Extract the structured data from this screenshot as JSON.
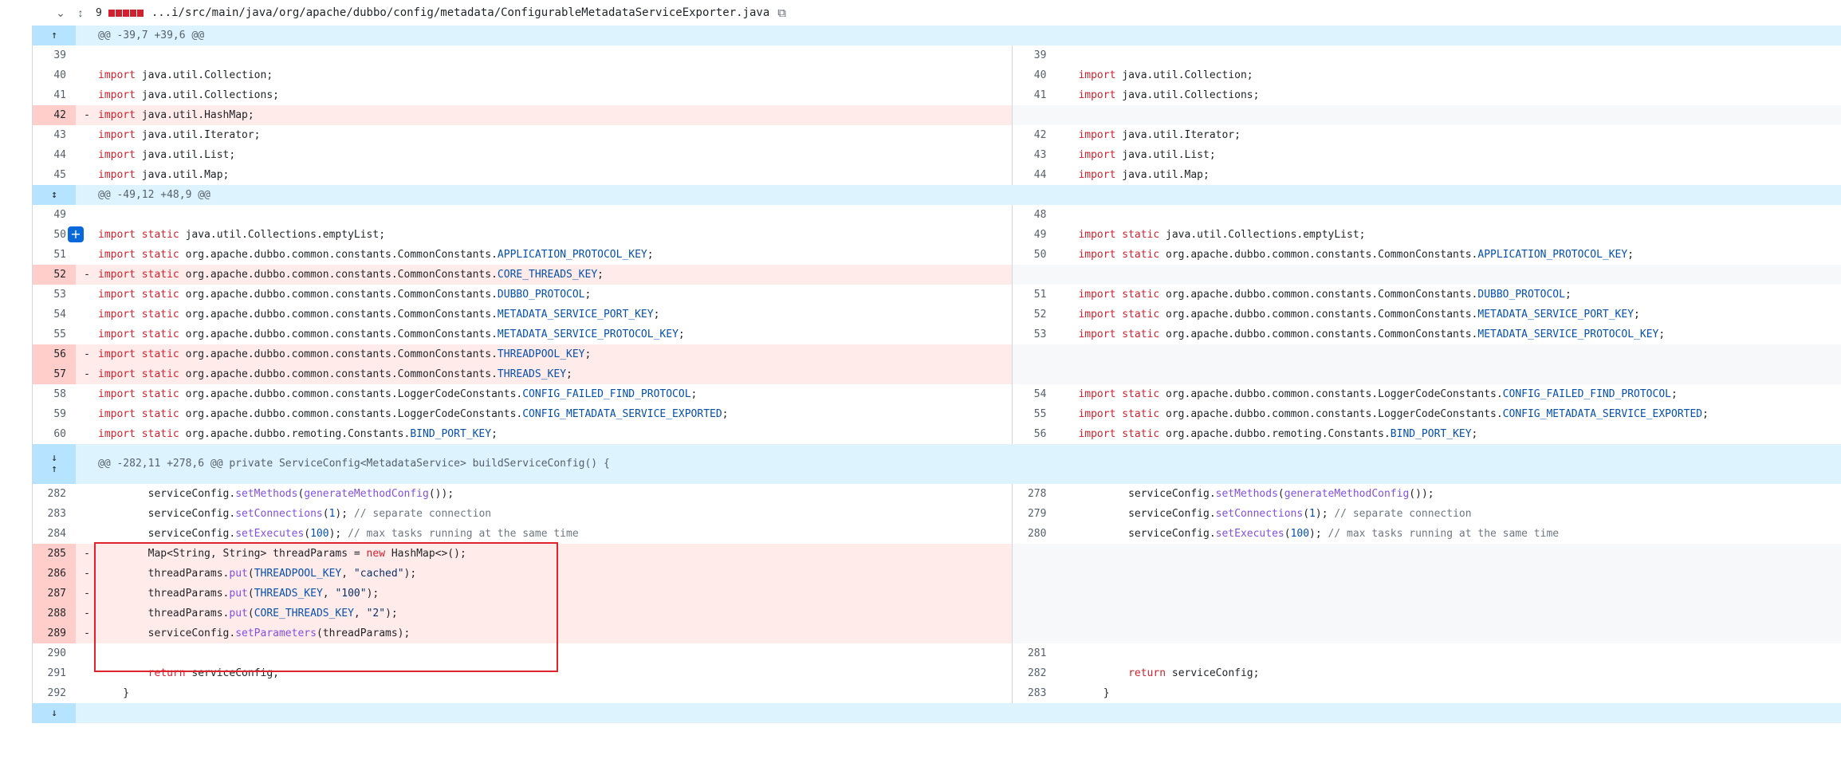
{
  "file_header": {
    "chevron": "chevron-down",
    "expand_icon": "unfold-icon",
    "change_count": "9",
    "path": "...i/src/main/java/org/apache/dubbo/config/metadata/ConfigurableMetadataServiceExporter.java",
    "copy_icon": "copy-icon"
  },
  "hunks": [
    {
      "header": "@@ -39,7 +39,6 @@",
      "rows": [
        {
          "l": "39",
          "lm": "",
          "lc": [],
          "r": "39",
          "rc": [],
          "t": "ctx"
        },
        {
          "l": "40",
          "lc": [
            [
              "kw",
              "import"
            ],
            [
              "",
              "java.util.Collection;"
            ]
          ],
          "r": "40",
          "rc": [
            [
              "kw",
              "import"
            ],
            [
              "",
              "java.util.Collection;"
            ]
          ],
          "t": "ctx"
        },
        {
          "l": "41",
          "lc": [
            [
              "kw",
              "import"
            ],
            [
              "",
              "java.util.Collections;"
            ]
          ],
          "r": "41",
          "rc": [
            [
              "kw",
              "import"
            ],
            [
              "",
              "java.util.Collections;"
            ]
          ],
          "t": "ctx"
        },
        {
          "l": "42",
          "lc": [
            [
              "kw",
              "import"
            ],
            [
              "",
              "java.util.HashMap;"
            ]
          ],
          "r": "",
          "rc": [],
          "t": "del"
        },
        {
          "l": "43",
          "lc": [
            [
              "kw",
              "import"
            ],
            [
              "",
              "java.util.Iterator;"
            ]
          ],
          "r": "42",
          "rc": [
            [
              "kw",
              "import"
            ],
            [
              "",
              "java.util.Iterator;"
            ]
          ],
          "t": "ctx"
        },
        {
          "l": "44",
          "lc": [
            [
              "kw",
              "import"
            ],
            [
              "",
              "java.util.List;"
            ]
          ],
          "r": "43",
          "rc": [
            [
              "kw",
              "import"
            ],
            [
              "",
              "java.util.List;"
            ]
          ],
          "t": "ctx"
        },
        {
          "l": "45",
          "lc": [
            [
              "kw",
              "import"
            ],
            [
              "",
              "java.util.Map;"
            ]
          ],
          "r": "44",
          "rc": [
            [
              "kw",
              "import"
            ],
            [
              "",
              "java.util.Map;"
            ]
          ],
          "t": "ctx"
        }
      ]
    },
    {
      "header": "@@ -49,12 +48,9 @@",
      "rows": [
        {
          "l": "49",
          "lc": [],
          "r": "48",
          "rc": [],
          "t": "ctx"
        },
        {
          "l": "50",
          "plus": true,
          "lc": [
            [
              "kw",
              "import static"
            ],
            [
              "",
              "java.util.Collections.emptyList;"
            ]
          ],
          "r": "49",
          "rc": [
            [
              "kw",
              "import static"
            ],
            [
              "",
              "java.util.Collections.emptyList;"
            ]
          ],
          "t": "ctx"
        },
        {
          "l": "51",
          "lc": [
            [
              "kw",
              "import static"
            ],
            [
              "",
              "org.apache.dubbo.common.constants.CommonConstants."
            ],
            [
              "const",
              "APPLICATION_PROTOCOL_KEY"
            ],
            [
              "",
              ";"
            ]
          ],
          "r": "50",
          "rc": [
            [
              "kw",
              "import static"
            ],
            [
              "",
              "org.apache.dubbo.common.constants.CommonConstants."
            ],
            [
              "const",
              "APPLICATION_PROTOCOL_KEY"
            ],
            [
              "",
              ";"
            ]
          ],
          "t": "ctx"
        },
        {
          "l": "52",
          "lc": [
            [
              "kw",
              "import static"
            ],
            [
              "",
              "org.apache.dubbo.common.constants.CommonConstants."
            ],
            [
              "const",
              "CORE_THREADS_KEY"
            ],
            [
              "",
              ";"
            ]
          ],
          "r": "",
          "rc": [],
          "t": "del"
        },
        {
          "l": "53",
          "lc": [
            [
              "kw",
              "import static"
            ],
            [
              "",
              "org.apache.dubbo.common.constants.CommonConstants."
            ],
            [
              "const",
              "DUBBO_PROTOCOL"
            ],
            [
              "",
              ";"
            ]
          ],
          "r": "51",
          "rc": [
            [
              "kw",
              "import static"
            ],
            [
              "",
              "org.apache.dubbo.common.constants.CommonConstants."
            ],
            [
              "const",
              "DUBBO_PROTOCOL"
            ],
            [
              "",
              ";"
            ]
          ],
          "t": "ctx"
        },
        {
          "l": "54",
          "lc": [
            [
              "kw",
              "import static"
            ],
            [
              "",
              "org.apache.dubbo.common.constants.CommonConstants."
            ],
            [
              "const",
              "METADATA_SERVICE_PORT_KEY"
            ],
            [
              "",
              ";"
            ]
          ],
          "r": "52",
          "rc": [
            [
              "kw",
              "import static"
            ],
            [
              "",
              "org.apache.dubbo.common.constants.CommonConstants."
            ],
            [
              "const",
              "METADATA_SERVICE_PORT_KEY"
            ],
            [
              "",
              ";"
            ]
          ],
          "t": "ctx"
        },
        {
          "l": "55",
          "lc": [
            [
              "kw",
              "import static"
            ],
            [
              "",
              "org.apache.dubbo.common.constants.CommonConstants."
            ],
            [
              "const",
              "METADATA_SERVICE_PROTOCOL_KEY"
            ],
            [
              "",
              ";"
            ]
          ],
          "r": "53",
          "rc": [
            [
              "kw",
              "import static"
            ],
            [
              "",
              "org.apache.dubbo.common.constants.CommonConstants."
            ],
            [
              "const",
              "METADATA_SERVICE_PROTOCOL_KEY"
            ],
            [
              "",
              ";"
            ]
          ],
          "t": "ctx"
        },
        {
          "l": "56",
          "lc": [
            [
              "kw",
              "import static"
            ],
            [
              "",
              "org.apache.dubbo.common.constants.CommonConstants."
            ],
            [
              "const",
              "THREADPOOL_KEY"
            ],
            [
              "",
              ";"
            ]
          ],
          "r": "",
          "rc": [],
          "t": "del"
        },
        {
          "l": "57",
          "lc": [
            [
              "kw",
              "import static"
            ],
            [
              "",
              "org.apache.dubbo.common.constants.CommonConstants."
            ],
            [
              "const",
              "THREADS_KEY"
            ],
            [
              "",
              ";"
            ]
          ],
          "r": "",
          "rc": [],
          "t": "del"
        },
        {
          "l": "58",
          "lc": [
            [
              "kw",
              "import static"
            ],
            [
              "",
              "org.apache.dubbo.common.constants.LoggerCodeConstants."
            ],
            [
              "const",
              "CONFIG_FAILED_FIND_PROTOCOL"
            ],
            [
              "",
              ";"
            ]
          ],
          "r": "54",
          "rc": [
            [
              "kw",
              "import static"
            ],
            [
              "",
              "org.apache.dubbo.common.constants.LoggerCodeConstants."
            ],
            [
              "const",
              "CONFIG_FAILED_FIND_PROTOCOL"
            ],
            [
              "",
              ";"
            ]
          ],
          "t": "ctx"
        },
        {
          "l": "59",
          "lc": [
            [
              "kw",
              "import static"
            ],
            [
              "",
              "org.apache.dubbo.common.constants.LoggerCodeConstants."
            ],
            [
              "const",
              "CONFIG_METADATA_SERVICE_EXPORTED"
            ],
            [
              "",
              ";"
            ]
          ],
          "r": "55",
          "rc": [
            [
              "kw",
              "import static"
            ],
            [
              "",
              "org.apache.dubbo.common.constants.LoggerCodeConstants."
            ],
            [
              "const",
              "CONFIG_METADATA_SERVICE_EXPORTED"
            ],
            [
              "",
              ";"
            ]
          ],
          "t": "ctx"
        },
        {
          "l": "60",
          "lc": [
            [
              "kw",
              "import static"
            ],
            [
              "",
              "org.apache.dubbo.remoting.Constants."
            ],
            [
              "const",
              "BIND_PORT_KEY"
            ],
            [
              "",
              ";"
            ]
          ],
          "r": "56",
          "rc": [
            [
              "kw",
              "import static"
            ],
            [
              "",
              "org.apache.dubbo.remoting.Constants."
            ],
            [
              "const",
              "BIND_PORT_KEY"
            ],
            [
              "",
              ";"
            ]
          ],
          "t": "ctx"
        }
      ]
    },
    {
      "header": "@@ -282,11 +278,6 @@ private ServiceConfig<MetadataService> buildServiceConfig() {",
      "rows": [
        {
          "l": "282",
          "lc": [
            [
              "",
              "        serviceConfig."
            ],
            [
              "fn",
              "setMethods"
            ],
            [
              "",
              "("
            ],
            [
              "fn",
              "generateMethodConfig"
            ],
            [
              "",
              "());"
            ]
          ],
          "r": "278",
          "rc": [
            [
              "",
              "        serviceConfig."
            ],
            [
              "fn",
              "setMethods"
            ],
            [
              "",
              "("
            ],
            [
              "fn",
              "generateMethodConfig"
            ],
            [
              "",
              "());"
            ]
          ],
          "t": "ctx"
        },
        {
          "l": "283",
          "lc": [
            [
              "",
              "        serviceConfig."
            ],
            [
              "fn",
              "setConnections"
            ],
            [
              "",
              "("
            ],
            [
              "const",
              "1"
            ],
            [
              "",
              "); "
            ],
            [
              "cm",
              "// separate connection"
            ]
          ],
          "r": "279",
          "rc": [
            [
              "",
              "        serviceConfig."
            ],
            [
              "fn",
              "setConnections"
            ],
            [
              "",
              "("
            ],
            [
              "const",
              "1"
            ],
            [
              "",
              "); "
            ],
            [
              "cm",
              "// separate connection"
            ]
          ],
          "t": "ctx"
        },
        {
          "l": "284",
          "lc": [
            [
              "",
              "        serviceConfig."
            ],
            [
              "fn",
              "setExecutes"
            ],
            [
              "",
              "("
            ],
            [
              "const",
              "100"
            ],
            [
              "",
              "); "
            ],
            [
              "cm",
              "// max tasks running at the same time"
            ]
          ],
          "r": "280",
          "rc": [
            [
              "",
              "        serviceConfig."
            ],
            [
              "fn",
              "setExecutes"
            ],
            [
              "",
              "("
            ],
            [
              "const",
              "100"
            ],
            [
              "",
              "); "
            ],
            [
              "cm",
              "// max tasks running at the same time"
            ]
          ],
          "t": "ctx"
        },
        {
          "l": "285",
          "lc": [
            [
              "",
              "        Map<String, String> threadParams = "
            ],
            [
              "kw",
              "new"
            ],
            [
              "",
              " HashMap<>();"
            ]
          ],
          "r": "",
          "rc": [],
          "t": "del"
        },
        {
          "l": "286",
          "lc": [
            [
              "",
              "        threadParams."
            ],
            [
              "fn",
              "put"
            ],
            [
              "",
              "("
            ],
            [
              "const",
              "THREADPOOL_KEY"
            ],
            [
              "",
              ", "
            ],
            [
              "str",
              "\"cached\""
            ],
            [
              "",
              ");"
            ]
          ],
          "r": "",
          "rc": [],
          "t": "del"
        },
        {
          "l": "287",
          "lc": [
            [
              "",
              "        threadParams."
            ],
            [
              "fn",
              "put"
            ],
            [
              "",
              "("
            ],
            [
              "const",
              "THREADS_KEY"
            ],
            [
              "",
              ", "
            ],
            [
              "str",
              "\"100\""
            ],
            [
              "",
              ");"
            ]
          ],
          "r": "",
          "rc": [],
          "t": "del"
        },
        {
          "l": "288",
          "lc": [
            [
              "",
              "        threadParams."
            ],
            [
              "fn",
              "put"
            ],
            [
              "",
              "("
            ],
            [
              "const",
              "CORE_THREADS_KEY"
            ],
            [
              "",
              ", "
            ],
            [
              "str",
              "\"2\""
            ],
            [
              "",
              ");"
            ]
          ],
          "r": "",
          "rc": [],
          "t": "del"
        },
        {
          "l": "289",
          "lc": [
            [
              "",
              "        serviceConfig."
            ],
            [
              "fn",
              "setParameters"
            ],
            [
              "",
              "(threadParams);"
            ]
          ],
          "r": "",
          "rc": [],
          "t": "del"
        },
        {
          "l": "290",
          "lc": [],
          "r": "281",
          "rc": [],
          "t": "ctx"
        },
        {
          "l": "291",
          "lc": [
            [
              "",
              "        "
            ],
            [
              "kw",
              "return"
            ],
            [
              "",
              " serviceConfig;"
            ]
          ],
          "r": "282",
          "rc": [
            [
              "",
              "        "
            ],
            [
              "kw",
              "return"
            ],
            [
              "",
              " serviceConfig;"
            ]
          ],
          "t": "ctx"
        },
        {
          "l": "292",
          "lc": [
            [
              "",
              "    }"
            ]
          ],
          "r": "283",
          "rc": [
            [
              "",
              "    }"
            ]
          ],
          "t": "ctx"
        }
      ]
    }
  ],
  "deletion_marker": "-",
  "plus_button_label": "+",
  "expand_up": "↑",
  "expand_down": "↓",
  "expand_both": "↕"
}
